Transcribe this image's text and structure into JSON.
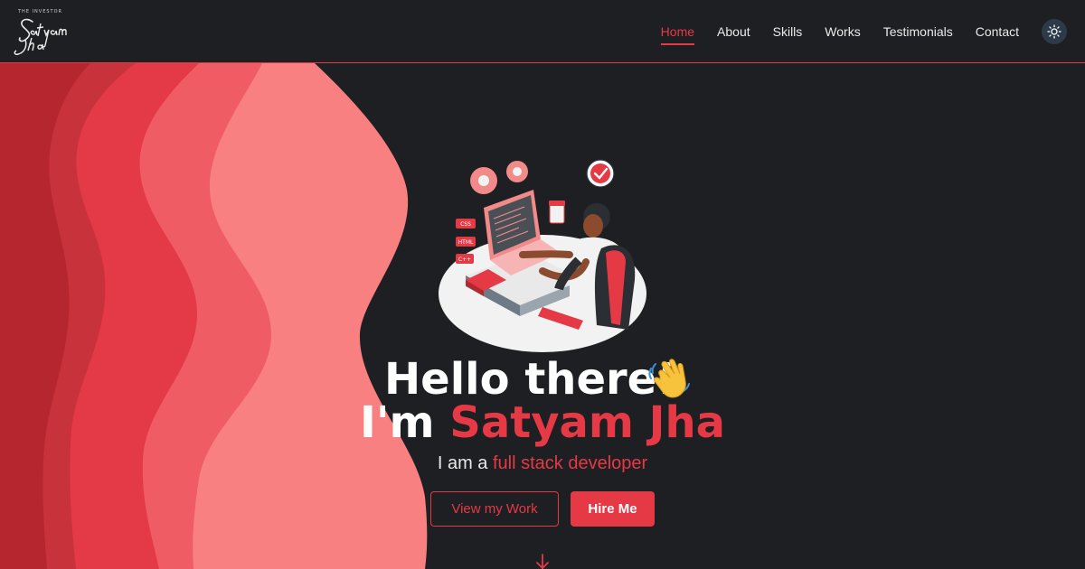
{
  "brand": {
    "tagline": "THE INVESTOR",
    "script_name": "Satyam Jha"
  },
  "nav": {
    "items": [
      {
        "label": "Home",
        "active": true
      },
      {
        "label": "About"
      },
      {
        "label": "Skills"
      },
      {
        "label": "Works"
      },
      {
        "label": "Testimonials"
      },
      {
        "label": "Contact"
      }
    ],
    "theme_icon": "sun-icon"
  },
  "hero": {
    "greeting": "Hello there!",
    "greeting_emoji": "waving-hand-icon",
    "intro_prefix": "I'm",
    "name": "Satyam Jha",
    "role_prefix": "I am a",
    "role": "full stack developer",
    "primary_button": "View my Work",
    "secondary_button": "Hire Me",
    "scroll_icon": "arrow-down-icon"
  },
  "illustration": {
    "labels": [
      "CSS",
      "HTML",
      "C++"
    ]
  },
  "colors": {
    "background": "#1d1f22",
    "accent": "#e63946",
    "nav_text": "#eaeaea",
    "toggle_bg": "#2c3a4a",
    "wave_1": "#b5262f",
    "wave_2": "#c7323b",
    "wave_3": "#e43a47",
    "wave_4": "#f05c64",
    "wave_5": "#f88080"
  }
}
